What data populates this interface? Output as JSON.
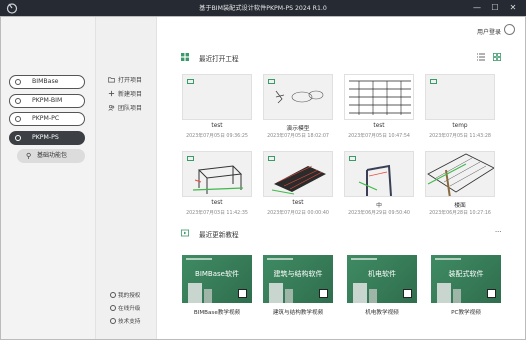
{
  "window": {
    "title": "基于BIM装配式设计软件PKPM-PS 2024 R1.0",
    "minimize": "—",
    "maximize": "☐",
    "close": "✕"
  },
  "products": [
    {
      "label": "BIMBase",
      "active": false
    },
    {
      "label": "PKPM-BIM",
      "active": false
    },
    {
      "label": "PKPM-PC",
      "active": false
    },
    {
      "label": "PKPM-PS",
      "active": true
    }
  ],
  "sub_item": {
    "label": "基础功能包"
  },
  "actions": {
    "open": "打开项目",
    "new": "新建项目",
    "team": "团队项目"
  },
  "footer": {
    "license": "我的授权",
    "update": "在线升级",
    "support": "技术支持"
  },
  "header": {
    "user": "用户登录"
  },
  "recent": {
    "title": "最近打开工程",
    "items": [
      {
        "name": "test",
        "date": "2023年07月05日 09:36:25"
      },
      {
        "name": "演示模型",
        "date": "2023年07月05日 18:02:07"
      },
      {
        "name": "test",
        "date": "2023年07月05日 10:47:54"
      },
      {
        "name": "temp",
        "date": "2023年07月05日 11:43:28"
      },
      {
        "name": "test",
        "date": "2023年07月03日 11:42:35"
      },
      {
        "name": "test",
        "date": "2023年07月02日 00:00:40"
      },
      {
        "name": "中",
        "date": "2023年06月29日 09:50:40"
      },
      {
        "name": "楼面",
        "date": "2023年06月28日 10:27:16"
      }
    ]
  },
  "tutorials": {
    "title": "最近更新教程",
    "more": "···",
    "items": [
      {
        "thumb_text": "BIMBase软件",
        "name": "BIMBase教学视频"
      },
      {
        "thumb_text": "建筑与结构软件",
        "name": "建筑与结构教学视频"
      },
      {
        "thumb_text": "机电软件",
        "name": "机电教学视频"
      },
      {
        "thumb_text": "装配式软件",
        "name": "PC教学视频"
      }
    ]
  },
  "colors": {
    "accent_green": "#3a9a6a",
    "titlebar": "#262b33",
    "active_product": "#3c3f44"
  }
}
